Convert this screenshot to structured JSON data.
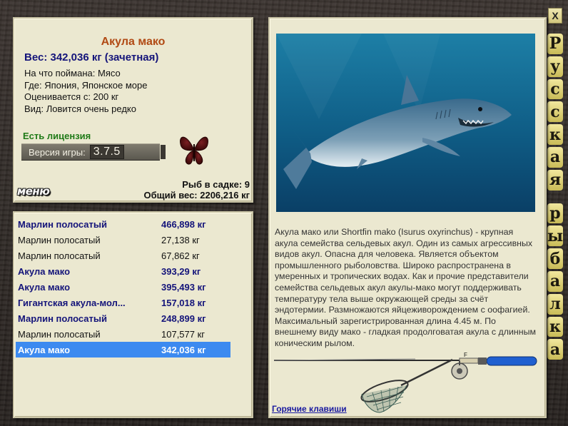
{
  "window": {
    "close_label": "X"
  },
  "side_title": {
    "letters": [
      "Р",
      "у",
      "с",
      "с",
      "к",
      "а",
      "я",
      "",
      "р",
      "ы",
      "б",
      "а",
      "л",
      "к",
      "а"
    ]
  },
  "catch_info": {
    "fish_name": "Акула мако",
    "weight_line": "Вес: 342,036 кг (зачетная)",
    "bait": "На что поймана: Мясо",
    "location": "Где: Япония, Японское море",
    "value": "Оценивается с: 200 кг",
    "rarity": "Вид: Ловится очень редко",
    "license": "Есть лицензия",
    "version_label": "Версия игры:",
    "version_value": "3.7.5",
    "menu_label": "меню",
    "fish_in_keepnet": "Рыб в садке: 9",
    "total_weight": "Общий вес: 2206,216 кг"
  },
  "catch_list": [
    {
      "name": "Марлин полосатый",
      "weight": "466,898 кг",
      "style": "bold"
    },
    {
      "name": "Марлин полосатый",
      "weight": "27,138 кг",
      "style": "normal"
    },
    {
      "name": "Марлин полосатый",
      "weight": "67,862 кг",
      "style": "normal"
    },
    {
      "name": "Акула мако",
      "weight": "393,29 кг",
      "style": "bold"
    },
    {
      "name": "Акула мако",
      "weight": "395,493 кг",
      "style": "bold"
    },
    {
      "name": "Гигантская акула-мол...",
      "weight": "157,018 кг",
      "style": "bold"
    },
    {
      "name": "Марлин полосатый",
      "weight": "248,899 кг",
      "style": "bold"
    },
    {
      "name": "Марлин полосатый",
      "weight": "107,577 кг",
      "style": "normal"
    },
    {
      "name": "Акула мако",
      "weight": "342,036 кг",
      "style": "selected"
    }
  ],
  "description": {
    "text": "Акула мако или Shortfin mako (Isurus oxyrinchus) - крупная акула семейства сельдевых акул. Один из самых агрессивных видов акул. Опасна для человека. Является объектом промышленного рыболовства. Широко распространена в умеренных и тропических водах. Как и прочие представители семейства сельдевых акул акулы-мако могут поддерживать температуру тела выше окружающей среды за счёт эндотермии. Размножаются яйцеживорождением с оофагией. Максимальный зарегистрированная длина 4.45 м. По внешнему виду мако - гладкая продолговатая акула с длинным коническим рылом.",
    "hotkeys_link": "Горячие клавиши",
    "reel_mark": "F"
  },
  "colors": {
    "panel_bg": "#ebe8d0",
    "fish_name": "#b14a14",
    "weight_title": "#14147a",
    "license": "#1f7a17",
    "selected_row": "#3c8af0",
    "link": "#1a1aa0"
  }
}
